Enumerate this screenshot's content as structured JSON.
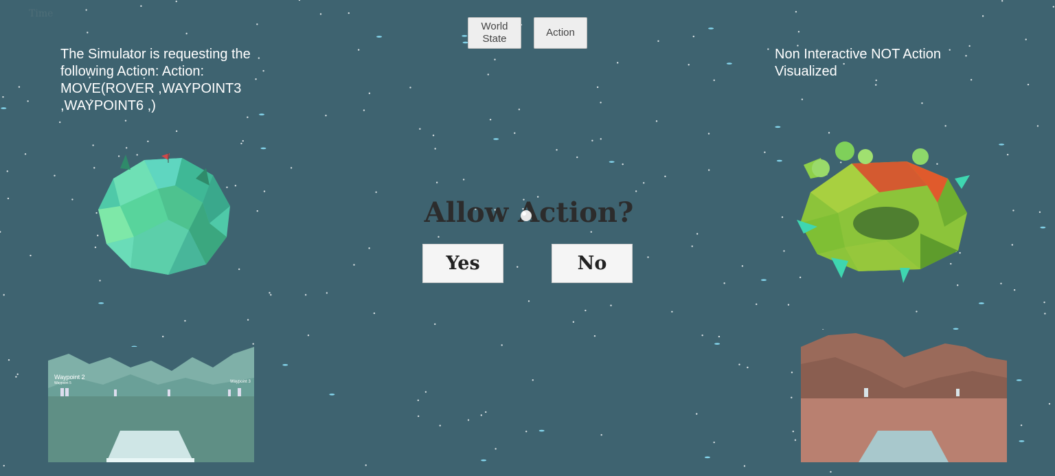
{
  "hud": {
    "time_label": "Time"
  },
  "toolbar": {
    "world_state_label": "World State",
    "action_label": "Action"
  },
  "left_panel": {
    "message": "The Simulator is requesting the following Action: Action: MOVE(ROVER ,WAYPOINT3 ,WAYPOINT6 ,)"
  },
  "right_panel": {
    "message": "Non Interactive NOT Action Visualized"
  },
  "dialog": {
    "title": "Allow Action?",
    "yes_label": "Yes",
    "no_label": "No"
  },
  "left_camera": {
    "waypoint_main": "Waypoint 2",
    "waypoint_sub": "Waypoint 5",
    "waypoint_far_right": "Waypoint 3",
    "colors": {
      "sky": "#6f9e98",
      "ground": "#5f8f85",
      "platform": "#cfe6e6"
    }
  },
  "right_camera": {
    "colors": {
      "sky": "#3e6370",
      "ground": "#b98070",
      "platform": "#a8c8cc"
    }
  },
  "colors": {
    "background": "#3e6370",
    "button_bg": "#eeeeee",
    "text_white": "#ffffff"
  }
}
